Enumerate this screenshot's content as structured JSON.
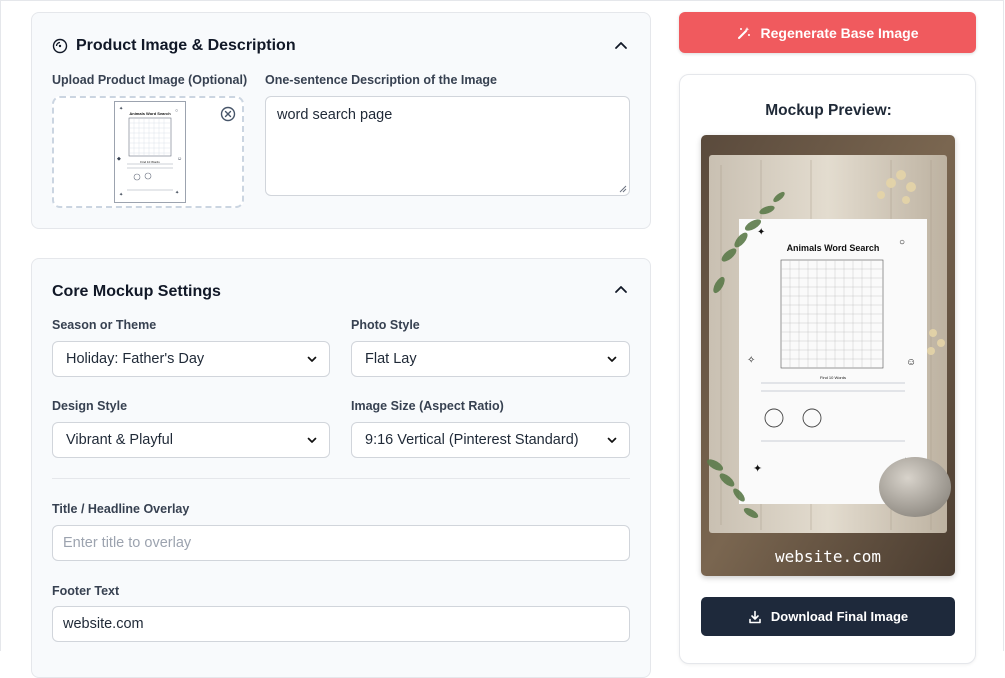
{
  "product_section": {
    "title": "Product Image & Description",
    "upload_label": "Upload Product Image (Optional)",
    "description_label": "One-sentence Description of the Image",
    "description_value": "word search page",
    "thumb_heading": "Animals Word Search",
    "thumb_subheading": "Find 10 Words"
  },
  "core_section": {
    "title": "Core Mockup Settings",
    "season_label": "Season or Theme",
    "season_value": "Holiday: Father's Day",
    "photo_style_label": "Photo Style",
    "photo_style_value": "Flat Lay",
    "design_style_label": "Design Style",
    "design_style_value": "Vibrant & Playful",
    "image_size_label": "Image Size (Aspect Ratio)",
    "image_size_value": "9:16 Vertical (Pinterest Standard)",
    "title_overlay_label": "Title / Headline Overlay",
    "title_overlay_placeholder": "Enter title to overlay",
    "title_overlay_value": "",
    "footer_label": "Footer Text",
    "footer_value": "website.com"
  },
  "sidebar": {
    "regenerate_label": "Regenerate Base Image",
    "preview_title": "Mockup Preview:",
    "mock_heading": "Animals Word Search",
    "mock_subheading": "Find 10 Words",
    "mock_footer": "website.com",
    "download_label": "Download Final Image"
  },
  "colors": {
    "regenerate_bg": "#f05a5e",
    "download_bg": "#1e293b",
    "card_bg": "#f8fafc"
  },
  "icons": {
    "section_icon": "palette-icon",
    "collapse_icon": "chevron-up-icon",
    "remove_icon": "close-circle-icon",
    "select_caret": "chevron-down-icon",
    "regenerate_icon": "wand-icon",
    "download_icon": "download-icon"
  }
}
